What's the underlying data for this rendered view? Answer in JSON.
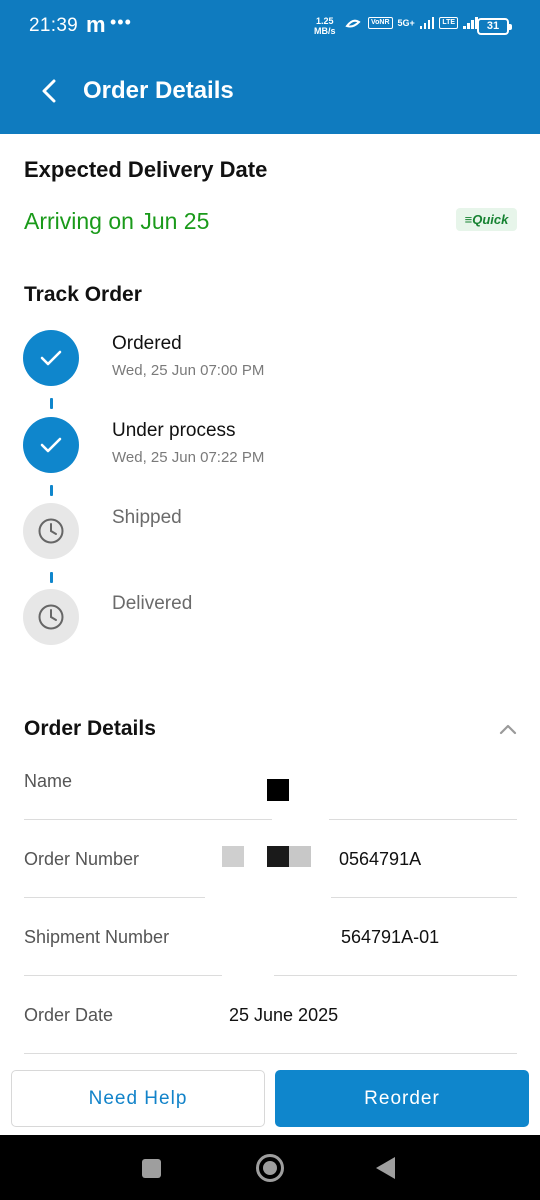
{
  "status_bar": {
    "time": "21:39",
    "app_indicator": "m",
    "more": "•••",
    "speed_value": "1.25",
    "speed_unit": "MB/s",
    "volte1": "Vo\nNR",
    "network": "5G+",
    "volte2": "Vo\nLTE",
    "battery": "31"
  },
  "app_bar": {
    "title": "Order Details",
    "back_icon": "chevron-left-icon"
  },
  "delivery": {
    "heading": "Expected Delivery Date",
    "arriving": "Arriving on Jun 25",
    "badge": "≡Quick"
  },
  "tracking": {
    "heading": "Track Order",
    "steps": [
      {
        "title": "Ordered",
        "time": "Wed, 25 Jun 07:00 PM",
        "status": "done"
      },
      {
        "title": "Under process",
        "time": "Wed, 25 Jun 07:22 PM",
        "status": "done"
      },
      {
        "title": "Shipped",
        "time": "",
        "status": "pending"
      },
      {
        "title": "Delivered",
        "time": "",
        "status": "pending"
      }
    ]
  },
  "order_details": {
    "heading": "Order Details",
    "rows": [
      {
        "label": "Name",
        "value": ""
      },
      {
        "label": "Order Number",
        "value": "0564791A"
      },
      {
        "label": "Shipment Number",
        "value": "564791A-01"
      },
      {
        "label": "Order Date",
        "value": "25 June 2025"
      }
    ]
  },
  "actions": {
    "help": "Need Help",
    "reorder": "Reorder"
  },
  "colors": {
    "primary": "#0f7bbf",
    "success": "#1a9a1a",
    "pending": "#e7e7e7"
  }
}
